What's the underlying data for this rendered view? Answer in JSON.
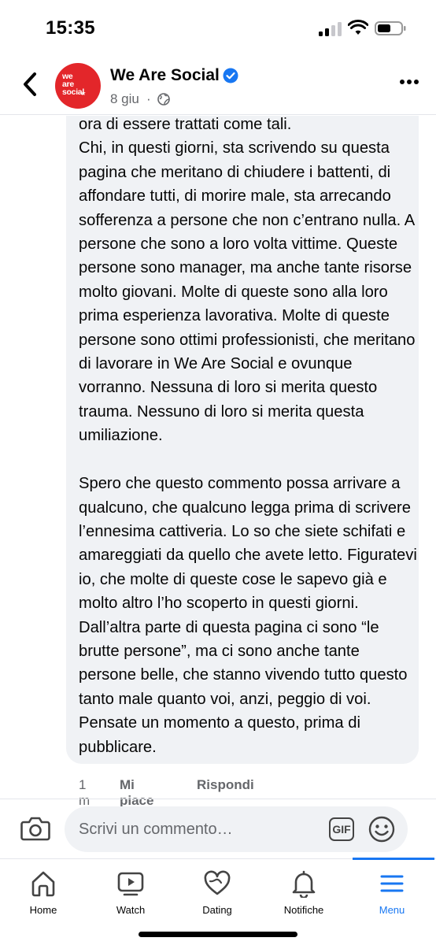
{
  "status_bar": {
    "time": "15:35"
  },
  "header": {
    "page_name": "We Are Social",
    "date": "8 giu",
    "separator": "·",
    "avatar_text": "we\nare\nsocial",
    "avatar_suffix": "IT"
  },
  "comment": {
    "text": "ora di essere trattati come tali.\nChi, in questi giorni, sta scrivendo su questa pagina che meritano di chiudere i battenti, di affondare tutti, di morire male, sta arrecando sofferenza a persone che non c’entrano nulla. A persone che sono a loro volta vittime. Queste persone sono manager, ma anche tante risorse molto giovani. Molte di queste sono alla loro prima esperienza lavorativa. Molte di queste persone sono ottimi professionisti, che meritano di lavorare in We Are Social e ovunque vorranno. Nessuna di loro si merita questo trauma. Nessuno di loro si merita questa umiliazione.\n\nSpero che questo commento possa arrivare a qualcuno, che qualcuno legga prima di scrivere l’ennesima cattiveria. Lo so che siete schifati e amareggiati da quello che avete letto. Figuratevi io, che molte di queste cose le sapevo già e molto altro l’ho scoperto in questi giorni.\nDall’altra parte di questa pagina ci sono “le brutte persone”, ma ci sono anche tante persone belle, che stanno vivendo tutto questo tanto male quanto voi, anzi, peggio di voi. Pensate un momento a questo, prima di pubblicare.",
    "time": "1 m",
    "like_label": "Mi piace",
    "reply_label": "Rispondi"
  },
  "composer": {
    "placeholder": "Scrivi un commento…",
    "gif_label": "GIF"
  },
  "bottom_nav": {
    "items": [
      {
        "label": "Home",
        "icon": "home-icon"
      },
      {
        "label": "Watch",
        "icon": "watch-icon"
      },
      {
        "label": "Dating",
        "icon": "dating-icon"
      },
      {
        "label": "Notifiche",
        "icon": "bell-icon"
      },
      {
        "label": "Menu",
        "icon": "menu-icon",
        "active": true
      }
    ]
  },
  "colors": {
    "brand_blue": "#1877f2",
    "avatar_red": "#e3262a",
    "secondary_text": "#65676b",
    "bubble_bg": "#f0f2f5"
  }
}
